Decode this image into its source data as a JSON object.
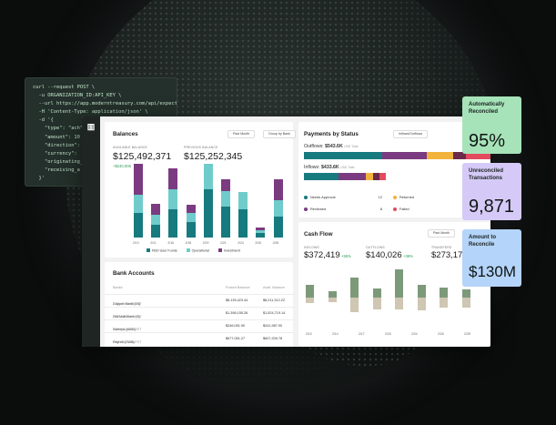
{
  "code_lines": [
    "curl --request POST \\",
    "  -u ORGANIZATION_ID:API_KEY \\",
    "  --url https://app.moderntreasury.com/api/expected",
    "  -H 'Content-Type: application/json' \\",
    "  -d '{",
    "    \"type\": \"ach\",",
    "    \"amount\": 10",
    "    \"direction\":",
    "    \"currency\":",
    "    \"originating_",
    "    \"receiving_a",
    "  }'"
  ],
  "balances": {
    "title": "Balances",
    "period": "Past Month",
    "group": "Group by Bank",
    "available_label": "Available Balance",
    "available_value": "$125,492,371",
    "available_change": "+$240,006",
    "previous_label": "Previous Balance",
    "previous_value": "$125,252,345",
    "x_labels": [
      "2/10",
      "2/11",
      "2/16",
      "2/18",
      "2/19",
      "2/21",
      "2/24",
      "2/26",
      "2/28"
    ],
    "legend": [
      "FBO User Funds",
      "Operational",
      "Investment"
    ],
    "colors": [
      "#177a7e",
      "#6fcccb",
      "#7b3b80"
    ],
    "stacks": [
      [
        34,
        26,
        44
      ],
      [
        18,
        14,
        16
      ],
      [
        40,
        28,
        30
      ],
      [
        22,
        12,
        12
      ],
      [
        68,
        36,
        0
      ],
      [
        44,
        22,
        16
      ],
      [
        40,
        24,
        0
      ],
      [
        6,
        4,
        4
      ],
      [
        30,
        22,
        30
      ]
    ]
  },
  "payments": {
    "title": "Payments by Status",
    "filter": "Inflows/Outflows",
    "period": "Past Mo",
    "outflows_label": "Outflows:",
    "outflows_value": "$543.6K",
    "outflows_unit": "USD Total",
    "inflows_label": "Inflows:",
    "inflows_value": "$433.6K",
    "inflows_unit": "USD Total",
    "statuses": [
      {
        "name": "Needs Approval",
        "count": "12",
        "color": "#177a7e"
      },
      {
        "name": "Returned",
        "count": "6",
        "color": "#f1b33c"
      },
      {
        "name": "Reviewed",
        "count": "8",
        "color": "#7b3b80"
      },
      {
        "name": "Failed",
        "count": "",
        "color": "#e24b5d"
      }
    ]
  },
  "cashflow": {
    "title": "Cash Flow",
    "period": "Past Month",
    "inflows_label": "Inflows",
    "inflows_value": "$372,419",
    "inflows_change": "+55%",
    "outflows_label": "Outflows",
    "outflows_value": "$140,026",
    "outflows_change": "+38%",
    "transfers_label": "Transfers",
    "transfers_value": "$273,173",
    "x_labels": [
      "2/10",
      "2/14",
      "2/17",
      "2/18",
      "2/24",
      "2/26",
      "2/28"
    ],
    "colors": [
      "#7c9a7a",
      "#cfc6b3"
    ],
    "inflows": [
      14,
      7,
      22,
      10,
      31,
      14,
      11,
      9
    ],
    "outflows": [
      4,
      3,
      10,
      8,
      8,
      9,
      7,
      7
    ]
  },
  "bank_accounts": {
    "title": "Bank Accounts",
    "columns": [
      "Banks",
      "Posted Balance",
      "Avail. Balance"
    ],
    "rows": [
      {
        "name": "Copper Bank (15)",
        "time": "2/22 10:06:18 PST",
        "posted": "$8,139,423.44",
        "avail": "$8,211,312.22"
      },
      {
        "name": "Old Mutt Bank (3)",
        "time": "2/22 10:06:18 PST",
        "posted": "$1,398,155.26",
        "avail": "$1,524,719.14"
      },
      {
        "name": "Sweeps (4091)",
        "time": "2/22 10:06:18 PST",
        "posted": "$246,051.90",
        "avail": "$241,987.90"
      },
      {
        "name": "Payroll (7108)",
        "time": "2/22 00:08:18 PST",
        "posted": "$677,051.27",
        "avail": "$607,209.78"
      }
    ]
  },
  "kpis": [
    {
      "title": "Automatically Reconciled",
      "value": "95%",
      "color": "#a7e3b9"
    },
    {
      "title": "Unreconciled Transactions",
      "value": "9,871",
      "color": "#d5caf7"
    },
    {
      "title": "Amount to Reconcile",
      "value": "$130M",
      "color": "#b4d4f9"
    }
  ]
}
